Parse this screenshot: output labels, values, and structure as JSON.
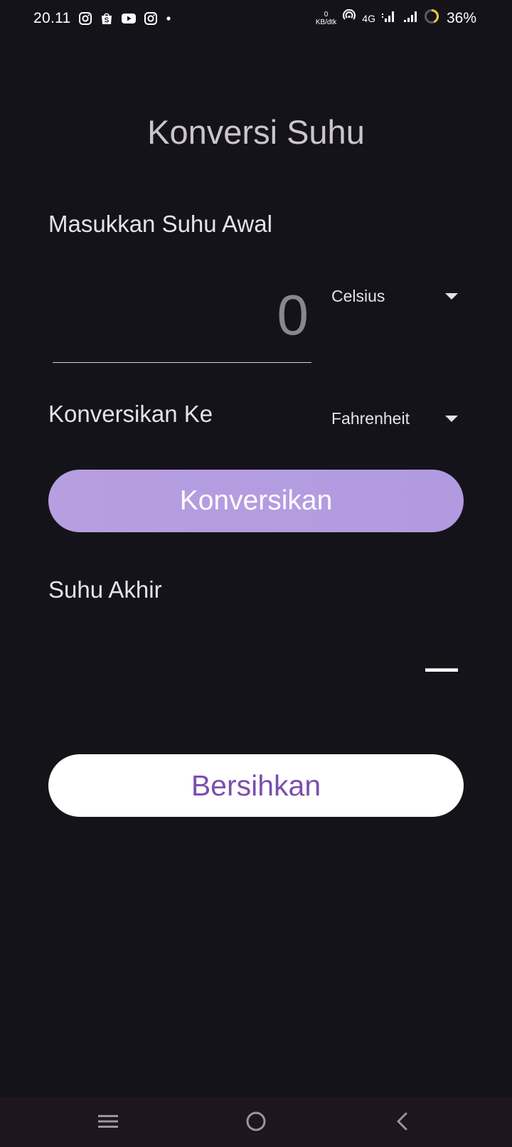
{
  "status_bar": {
    "time": "20.11",
    "notification_icons": [
      "instagram-icon",
      "shopee-icon",
      "youtube-icon",
      "instagram-icon",
      "dot-icon"
    ],
    "net_speed_value": "0",
    "net_speed_unit": "KB/dtk",
    "network_type": "4G",
    "battery_percent": "36%",
    "battery_ring_color": "#f5c542"
  },
  "app": {
    "title": "Konversi Suhu"
  },
  "input_section": {
    "label": "Masukkan Suhu Awal",
    "value": "",
    "placeholder": "0",
    "from_unit": "Celsius"
  },
  "convert_section": {
    "label": "Konversikan Ke",
    "to_unit": "Fahrenheit",
    "button_label": "Konversikan",
    "button_color": "#b39ddf"
  },
  "result_section": {
    "label": "Suhu Akhir",
    "value": "—"
  },
  "clear_button": {
    "label": "Bersihkan",
    "text_color": "#7a4fad"
  },
  "nav_bar": {
    "buttons": [
      "menu-icon",
      "home-icon",
      "back-icon"
    ]
  }
}
